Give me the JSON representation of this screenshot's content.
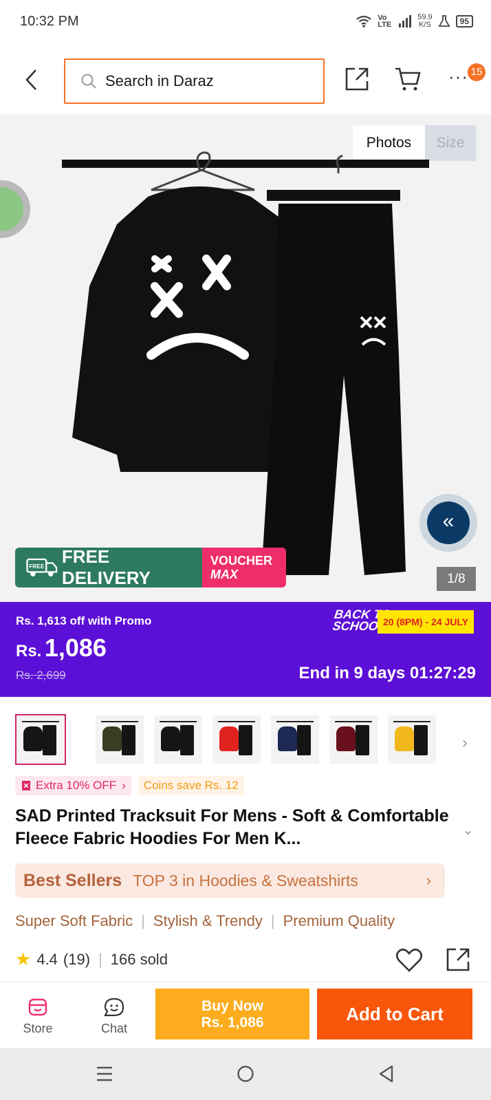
{
  "status": {
    "time": "10:32 PM",
    "net_label": "Vo LTE",
    "speed": "59.9",
    "speed_unit": "K/S",
    "battery": "95"
  },
  "header": {
    "search_placeholder": "Search in Daraz",
    "cart_badge": "15"
  },
  "gallery": {
    "tab_photos": "Photos",
    "tab_size": "Size",
    "counter": "1/8",
    "free_delivery": "FREE DELIVERY",
    "free_small": "FREE",
    "voucher_line1": "VOUCHER",
    "voucher_line2": "MAX"
  },
  "promo": {
    "off_text": "Rs. 1,613 off with Promo",
    "currency": "Rs.",
    "price": "1,086",
    "old_price": "Rs. 2,699",
    "campaign_line1": "BACK TO",
    "campaign_line2": "SCHOOL",
    "dates": "20 (8PM) - 24 JULY",
    "ends": "End in 9 days 01:27:29"
  },
  "thumbnails": [
    {
      "color": "#151515"
    },
    {
      "color": "#3a3d22"
    },
    {
      "color": "#151515"
    },
    {
      "color": "#e0231f"
    },
    {
      "color": "#1c2a55"
    },
    {
      "color": "#6a0f1c"
    },
    {
      "color": "#f1b81d"
    }
  ],
  "tags": {
    "extra_off": "Extra 10% OFF",
    "coins": "Coins save Rs. 12"
  },
  "product": {
    "title": "SAD Printed Tracksuit For Mens - Soft & Comfortable Fleece Fabric Hoodies For Men K...",
    "best_sellers": "Best Sellers",
    "ranking": "TOP 3 in Hoodies & Sweatshirts",
    "features": [
      "Super Soft Fabric",
      "Stylish & Trendy",
      "Premium Quality"
    ],
    "rating": "4.4",
    "reviews": "(19)",
    "sold": "166 sold"
  },
  "bottom": {
    "store": "Store",
    "chat": "Chat",
    "buy_now": "Buy Now",
    "buy_price": "Rs. 1,086",
    "add_to_cart": "Add to Cart"
  }
}
